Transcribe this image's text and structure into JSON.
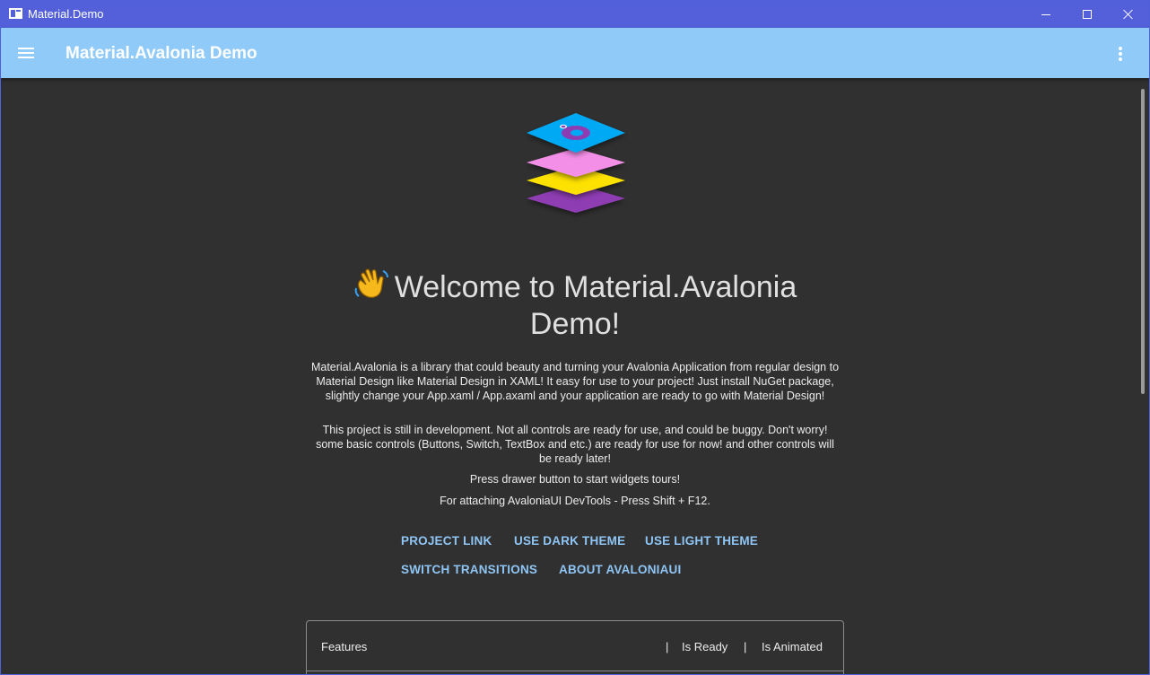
{
  "window": {
    "title": "Material.Demo",
    "icons": {
      "app": "app-window-icon",
      "minimize": "minimize-icon",
      "maximize": "maximize-icon",
      "close": "close-icon"
    }
  },
  "appbar": {
    "title": "Material.Avalonia Demo",
    "color": "#90caf9",
    "menu_icon": "hamburger-icon",
    "more_icon": "more-vert-icon"
  },
  "welcome": {
    "emoji": "👋",
    "title": "Welcome to Material.Avalonia Demo!"
  },
  "paragraphs": {
    "intro": "Material.Avalonia is a library that could beauty and turning your Avalonia Application from regular design to Material Design like Material Design in XAML! It easy for use to your project! Just install NuGet package, slightly change your App.xaml / App.axaml and your application are ready to go with Material Design!",
    "development": "This project is still in development. Not all controls are ready for use, and could be buggy. Don't worry! some basic controls (Buttons, Switch, TextBox and etc.) are ready for use for now! and other controls will be ready later!",
    "drawer_hint": "Press drawer button to start widgets tours!",
    "devtools_hint": "For attaching AvaloniaUI DevTools - Press Shift + F12."
  },
  "actions": {
    "project_link": "PROJECT LINK",
    "dark_theme": "USE DARK THEME",
    "light_theme": "USE LIGHT THEME",
    "switch_transitions": "SWITCH TRANSITIONS",
    "about_avaloniaui": "ABOUT AVALONIAUI"
  },
  "features_table": {
    "headers": [
      "Features",
      "Is Ready",
      "Is Animated"
    ],
    "separator": "|"
  },
  "colors": {
    "titlebar": "#5360d9",
    "background": "#303030",
    "accent_text": "#8ec5f5",
    "logo_layers": [
      "#03a9f4",
      "#f48fe8",
      "#fde100",
      "#8e3cb2"
    ]
  }
}
